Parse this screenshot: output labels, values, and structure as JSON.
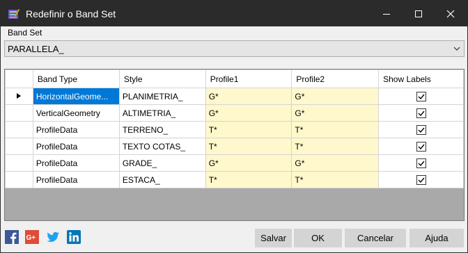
{
  "window": {
    "title": "Redefinir o Band Set"
  },
  "band_set": {
    "label": "Band Set",
    "value": "PARALLELA_"
  },
  "grid": {
    "columns": [
      "Band Type",
      "Style",
      "Profile1",
      "Profile2",
      "Show Labels"
    ],
    "rows": [
      {
        "band_type": "HorizontalGeome...",
        "style": "PLANIMETRIA_",
        "profile1": "G*",
        "profile2": "G*",
        "show_labels": true
      },
      {
        "band_type": "VerticalGeometry",
        "style": "ALTIMETRIA_",
        "profile1": "G*",
        "profile2": "G*",
        "show_labels": true
      },
      {
        "band_type": "ProfileData",
        "style": "TERRENO_",
        "profile1": "T*",
        "profile2": "T*",
        "show_labels": true
      },
      {
        "band_type": "ProfileData",
        "style": "TEXTO COTAS_",
        "profile1": "T*",
        "profile2": "T*",
        "show_labels": true
      },
      {
        "band_type": "ProfileData",
        "style": "GRADE_",
        "profile1": "G*",
        "profile2": "G*",
        "show_labels": true
      },
      {
        "band_type": "ProfileData",
        "style": "ESTACA_",
        "profile1": "T*",
        "profile2": "T*",
        "show_labels": true
      }
    ]
  },
  "buttons": {
    "save": "Salvar",
    "ok": "OK",
    "cancel": "Cancelar",
    "help": "Ajuda"
  },
  "social": [
    "facebook-icon",
    "google-plus-icon",
    "twitter-icon",
    "linkedin-icon"
  ],
  "colors": {
    "titlebar": "#2b2b2b",
    "selection": "#0078d7",
    "profile_cell": "#fff8cc",
    "grid_empty": "#a9a9a9"
  }
}
